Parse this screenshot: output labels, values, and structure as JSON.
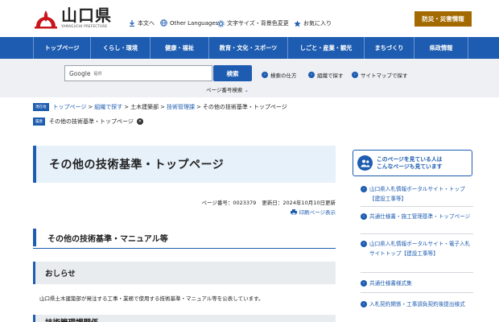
{
  "header": {
    "logo_title": "山口県",
    "logo_sub": "YAMAGUCHI PREFECTURE",
    "util_links": [
      "本文へ",
      "Other Languages",
      "文字サイズ・背景色変更",
      "お気に入り"
    ],
    "bousai": "防災・災害情報"
  },
  "gnav": [
    "トップページ",
    "くらし・環境",
    "健康・福祉",
    "教育・文化・スポーツ",
    "しごと・産業・観光",
    "まちづくり",
    "県政情報"
  ],
  "search": {
    "brand": "Google",
    "brand_sub": "提供",
    "button": "検索",
    "page_number_search": "ページ番号検索",
    "links": [
      "検索の仕方",
      "組織で探す",
      "サイトマップで探す"
    ]
  },
  "breadcrumb": {
    "tag": "現在地",
    "items": [
      "トップページ",
      "組織で探す",
      "土木建築部",
      "技術管理課",
      "その他の技術基準・トップページ"
    ]
  },
  "history": {
    "tag": "履歴",
    "item": "その他の技術基準・トップページ"
  },
  "main": {
    "title": "その他の技術基準・トップページ",
    "page_number": "ページ番号：0023379",
    "updated": "更新日：2024年10月10日更新",
    "print": "印刷ページ表示",
    "h2": "その他の技術基準・マニュアル等",
    "h3_notice": "おしらせ",
    "notice_text": "山口県土木建築部が発注する工事・業務で使用する技術基準・マニュアル等を公表しています。",
    "h3_next": "技術管理課関係"
  },
  "sidebar": {
    "head": [
      "このページを見ている人は",
      "こんなページも見ています"
    ],
    "items": [
      "山口県入札情報ポータルサイト・トップ【建設工事等】",
      "共通仕様書・施工管理基準・トップページ",
      "山口県入札情報ポータルサイト・電子入札サイトトップ【建設工事等】",
      "共通仕様書様式集",
      "入札契約関係・工事請負契約後提出様式"
    ]
  },
  "colors": {
    "brand_blue": "#1d5cb0",
    "disaster_button": "#a36a00",
    "title_bg": "#e7f1fa"
  }
}
